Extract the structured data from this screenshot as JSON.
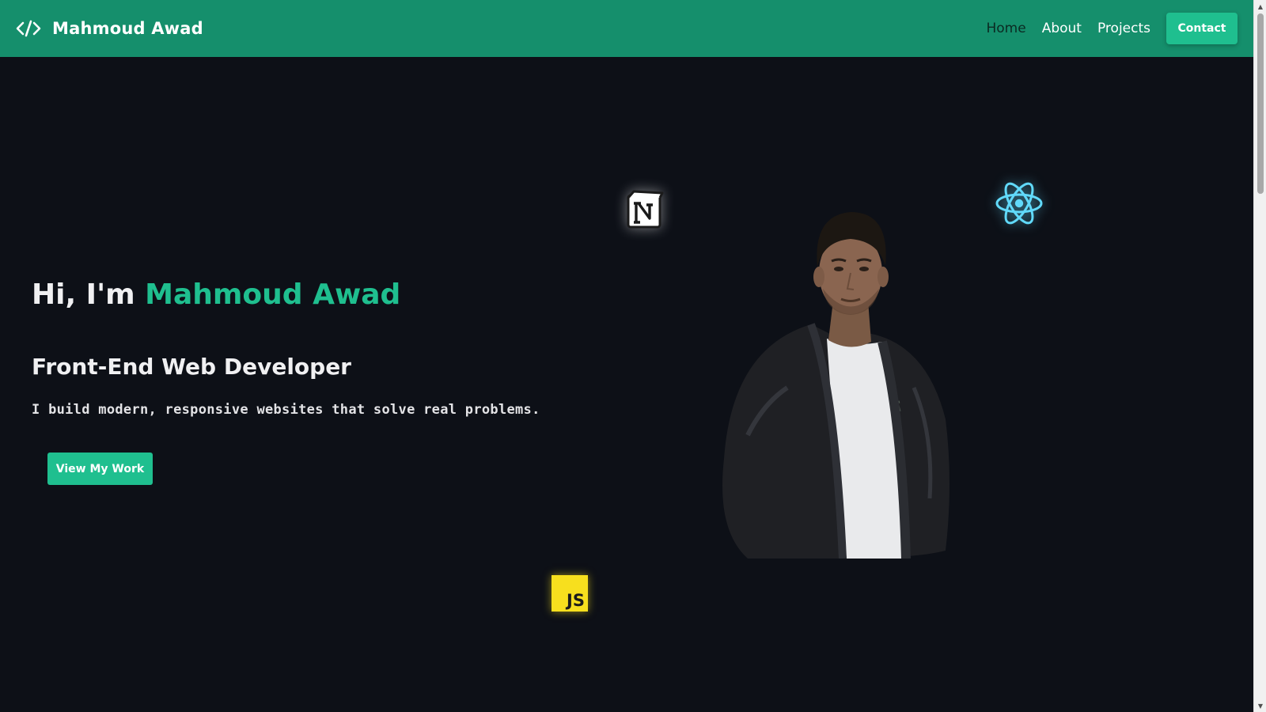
{
  "brand": {
    "icon": "code-icon",
    "name": "Mahmoud Awad"
  },
  "nav": {
    "links": [
      {
        "label": "Home",
        "active": true
      },
      {
        "label": "About",
        "active": false
      },
      {
        "label": "Projects",
        "active": false
      }
    ],
    "contact_label": "Contact"
  },
  "hero": {
    "greeting_prefix": "Hi, I'm",
    "name": "Mahmoud Awad",
    "role": "Front-End Web Developer",
    "tagline": "I build modern, responsive websites that solve real problems.",
    "cta_label": "View My Work"
  },
  "floating_icons": {
    "notion": "notion-icon",
    "react": "react-icon",
    "javascript": "JS"
  },
  "colors": {
    "navbar": "#158f6c",
    "accent": "#1fbf8f",
    "background": "#0d1017",
    "active_nav": "#0b2a22"
  }
}
